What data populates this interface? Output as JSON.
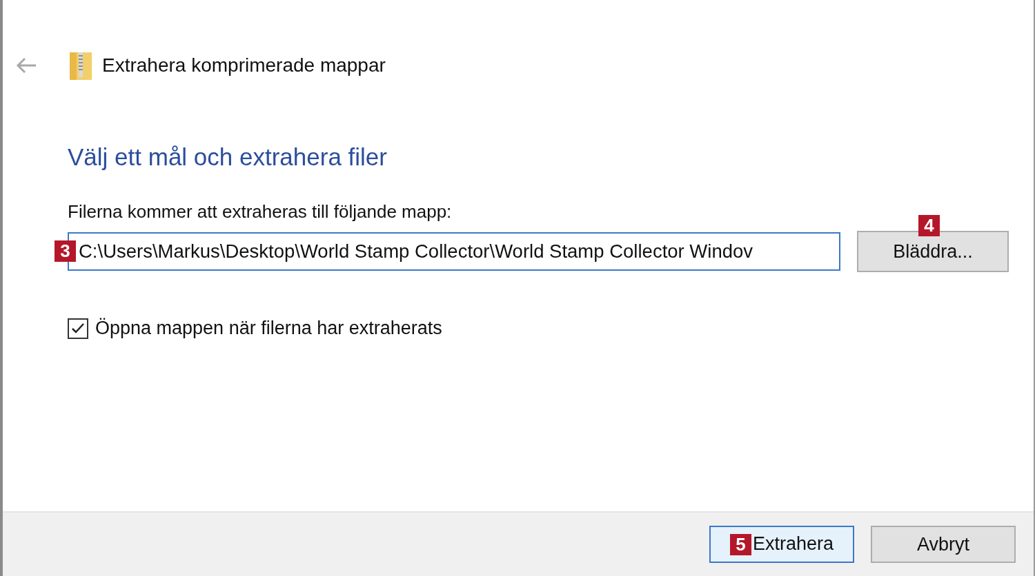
{
  "window": {
    "title": "Extrahera komprimerade mappar"
  },
  "heading": "Välj ett mål och extrahera filer",
  "destination": {
    "label": "Filerna kommer att extraheras till följande mapp:",
    "value": "C:\\Users\\Markus\\Desktop\\World Stamp Collector\\World Stamp Collector Windov",
    "badge": "3",
    "browse_button": {
      "label": "Bläddra...",
      "badge": "4"
    }
  },
  "open_folder_checkbox": {
    "label": "Öppna mappen när filerna har extraherats",
    "checked": true
  },
  "buttons": [
    {
      "label": "Extrahera",
      "default": true,
      "badge": "5"
    },
    {
      "label": "Avbryt",
      "default": false
    }
  ]
}
